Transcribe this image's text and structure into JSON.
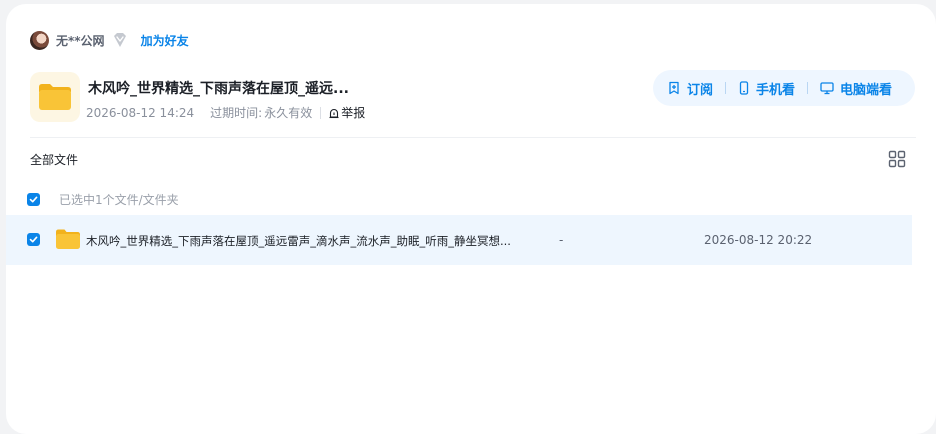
{
  "user": {
    "name": "无**公网",
    "add_friend_label": "加为好友"
  },
  "share": {
    "title": "木风吟_世界精选_下雨声落在屋顶_遥远...",
    "created": "2026-08-12 14:24",
    "expire_label": "过期时间:",
    "expire_value": "永久有效",
    "report_label": "举报"
  },
  "actions": {
    "subscribe_label": "订阅",
    "phone_label": "手机看",
    "pc_label": "电脑端看"
  },
  "file_list": {
    "breadcrumb": "全部文件",
    "selected_text": "已选中1个文件/文件夹",
    "items": [
      {
        "name": "木风吟_世界精选_下雨声落在屋顶_遥远雷声_滴水声_流水声_助眠_听雨_静坐冥想...",
        "size": "-",
        "date": "2026-08-12 20:22",
        "selected": true
      }
    ]
  },
  "colors": {
    "accent": "#0a84e8",
    "folder": "#f9c437",
    "selected_row": "#eef6fe",
    "action_bar": "#eef6ff"
  },
  "icons": {
    "vip": "diamond-icon",
    "report": "alarm-icon",
    "subscribe": "bookmark-plus-icon",
    "phone": "phone-icon",
    "pc": "monitor-icon",
    "view_toggle": "grid-icon",
    "folder": "folder-icon",
    "check": "check-icon"
  }
}
